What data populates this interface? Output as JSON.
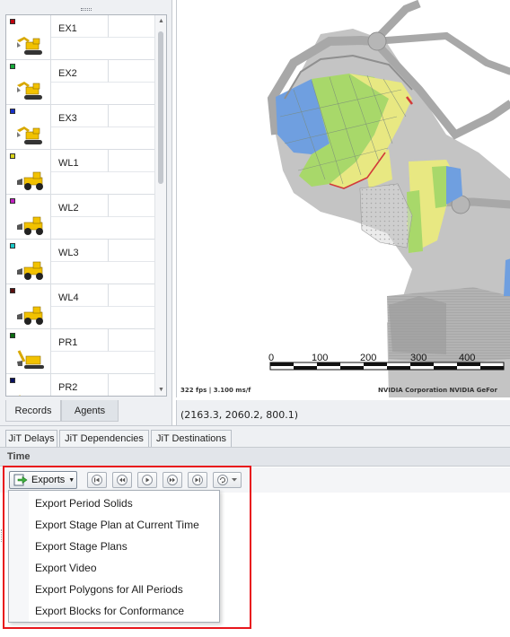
{
  "agents": [
    {
      "name": "EX1",
      "color": "#c0000f",
      "kind": "excavator"
    },
    {
      "name": "EX2",
      "color": "#16a83a",
      "kind": "excavator"
    },
    {
      "name": "EX3",
      "color": "#1730c8",
      "kind": "excavator"
    },
    {
      "name": "WL1",
      "color": "#d8d218",
      "kind": "wheel-loader"
    },
    {
      "name": "WL2",
      "color": "#c020c0",
      "kind": "wheel-loader"
    },
    {
      "name": "WL3",
      "color": "#18c8c8",
      "kind": "wheel-loader"
    },
    {
      "name": "WL4",
      "color": "#5a1010",
      "kind": "wheel-loader"
    },
    {
      "name": "PR1",
      "color": "#0a6a10",
      "kind": "power-shovel"
    },
    {
      "name": "PR2",
      "color": "#0a1260",
      "kind": "power-shovel"
    }
  ],
  "left_tabs": {
    "records": "Records",
    "agents": "Agents"
  },
  "viewport": {
    "scale_labels": [
      "0",
      "100",
      "200",
      "300",
      "400"
    ],
    "perf": "322 fps | 3.100 ms/f",
    "gpu": "NVIDIA Corporation NVIDIA GeFor",
    "coords": "(2163.3, 2060.2, 800.1)"
  },
  "bottom_tabs": {
    "delays": "JiT Delays",
    "dependencies": "JiT Dependencies",
    "destinations": "JiT Destinations"
  },
  "time_panel": {
    "title": "Time"
  },
  "toolbar": {
    "exports_label": "Exports"
  },
  "export_menu": [
    "Export Period Solids",
    "Export Stage Plan at Current Time",
    "Export Stage Plans",
    "Export Video",
    "Export Polygons for All Periods",
    "Export Blocks for Conformance"
  ],
  "colors": {
    "highlight": "#e8161c",
    "vehicle": "#f2c200"
  }
}
